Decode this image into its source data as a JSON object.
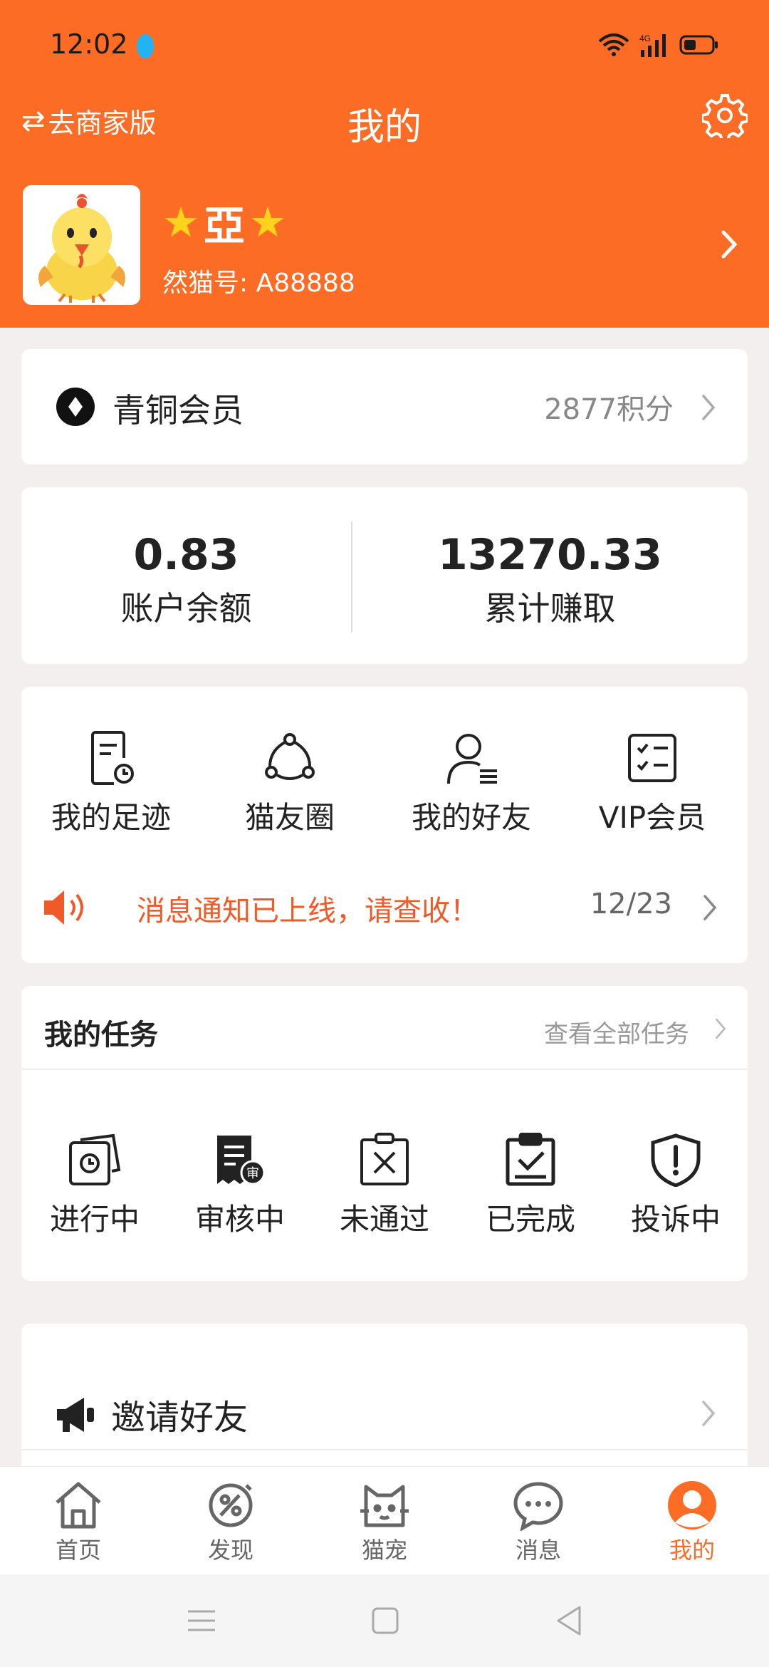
{
  "status": {
    "time": "12:02"
  },
  "header": {
    "switch_label": "去商家版",
    "title": "我的"
  },
  "profile": {
    "nickname": "亞",
    "user_id": "然猫号: A88888"
  },
  "member": {
    "level": "青铜会员",
    "points": "2877积分"
  },
  "balance": {
    "account_value": "0.83",
    "account_label": "账户余额",
    "earned_value": "13270.33",
    "earned_label": "累计赚取"
  },
  "shortcuts": [
    {
      "label": "我的足迹",
      "icon": "footprint-icon"
    },
    {
      "label": "猫友圈",
      "icon": "circle-icon"
    },
    {
      "label": "我的好友",
      "icon": "friends-icon"
    },
    {
      "label": "VIP会员",
      "icon": "vip-icon"
    }
  ],
  "notice": {
    "text": "消息通知已上线，请查收！",
    "count": "12/23"
  },
  "tasks": {
    "title": "我的任务",
    "view_all": "查看全部任务",
    "items": [
      {
        "label": "进行中",
        "icon": "in-progress-icon"
      },
      {
        "label": "审核中",
        "icon": "reviewing-icon"
      },
      {
        "label": "未通过",
        "icon": "rejected-icon"
      },
      {
        "label": "已完成",
        "icon": "completed-icon"
      },
      {
        "label": "投诉中",
        "icon": "complaint-icon"
      }
    ]
  },
  "invite": {
    "label": "邀请好友"
  },
  "nav": [
    {
      "label": "首页",
      "icon": "home-icon"
    },
    {
      "label": "发现",
      "icon": "discover-icon"
    },
    {
      "label": "猫宠",
      "icon": "cat-icon"
    },
    {
      "label": "消息",
      "icon": "message-icon"
    },
    {
      "label": "我的",
      "icon": "profile-icon"
    }
  ],
  "colors": {
    "brand": "#fc6c25",
    "notice": "#f05a28",
    "background": "#f2efee"
  }
}
